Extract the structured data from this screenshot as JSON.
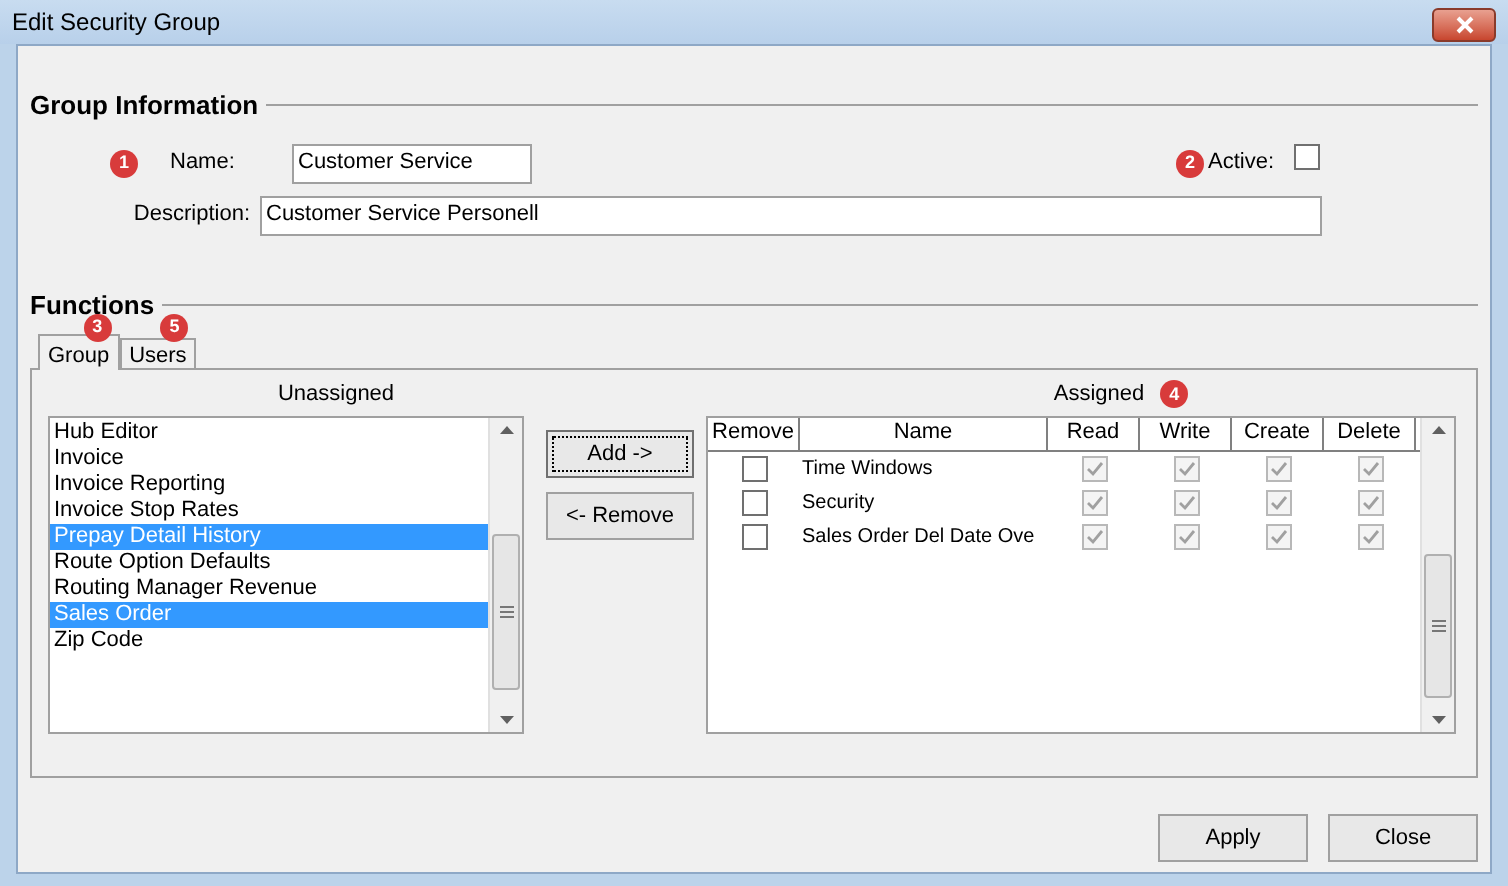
{
  "window": {
    "title": "Edit Security Group"
  },
  "group_information": {
    "heading": "Group Information",
    "name_label": "Name:",
    "name_value": "Customer Service",
    "name_badge": "1",
    "active_badge": "2",
    "active_label": "Active:",
    "active_checked": false,
    "description_label": "Description:",
    "description_value": "Customer Service Personell"
  },
  "functions": {
    "heading": "Functions",
    "tabs": [
      {
        "label": "Group",
        "selected": true,
        "badge": "3"
      },
      {
        "label": "Users",
        "selected": false,
        "badge": "5"
      }
    ],
    "unassigned": {
      "label": "Unassigned",
      "items": [
        {
          "label": "Hub Editor",
          "selected": false
        },
        {
          "label": "Invoice",
          "selected": false
        },
        {
          "label": "Invoice Reporting",
          "selected": false
        },
        {
          "label": "Invoice Stop Rates",
          "selected": false
        },
        {
          "label": "Prepay Detail History",
          "selected": true
        },
        {
          "label": "Route Option Defaults",
          "selected": false
        },
        {
          "label": "Routing Manager Revenue",
          "selected": false
        },
        {
          "label": "Sales Order",
          "selected": true
        },
        {
          "label": "Zip Code",
          "selected": false
        }
      ]
    },
    "add_button": "Add ->",
    "remove_button": "<- Remove",
    "assigned": {
      "label": "Assigned",
      "badge": "4",
      "columns": [
        "Remove",
        "Name",
        "Read",
        "Write",
        "Create",
        "Delete"
      ],
      "rows": [
        {
          "remove": false,
          "name": "Time Windows",
          "read": true,
          "write": true,
          "create": true,
          "delete": true
        },
        {
          "remove": false,
          "name": "Security",
          "read": true,
          "write": true,
          "create": true,
          "delete": true
        },
        {
          "remove": false,
          "name": "Sales Order Del Date Ove",
          "read": true,
          "write": true,
          "create": true,
          "delete": true
        }
      ]
    }
  },
  "buttons": [
    "Apply",
    "Close"
  ]
}
